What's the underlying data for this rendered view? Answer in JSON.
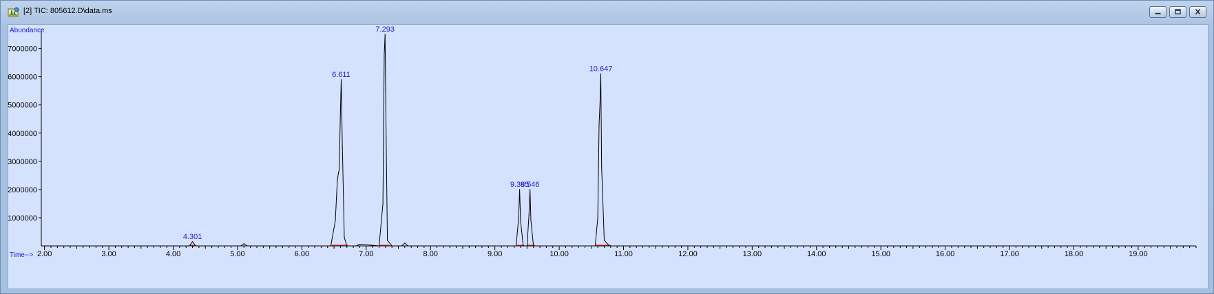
{
  "window": {
    "title": "[2] TIC: 805612.D\\data.ms",
    "icon": "chromatogram-app-icon",
    "controls": [
      "minimize",
      "restore",
      "close"
    ]
  },
  "chart_data": {
    "type": "line",
    "title": "",
    "xlabel": "Time-->",
    "ylabel": "Abundance",
    "xlim": [
      1.95,
      19.9
    ],
    "ylim": [
      0,
      7600000
    ],
    "x_ticks": [
      2.0,
      3.0,
      4.0,
      5.0,
      6.0,
      7.0,
      8.0,
      9.0,
      10.0,
      11.0,
      12.0,
      13.0,
      14.0,
      15.0,
      16.0,
      17.0,
      18.0,
      19.0
    ],
    "x_tick_labels": [
      "2.00",
      "3.00",
      "4.00",
      "5.00",
      "6.00",
      "7.00",
      "8.00",
      "9.00",
      "10.00",
      "11.00",
      "12.00",
      "13.00",
      "14.00",
      "15.00",
      "16.00",
      "17.00",
      "18.00",
      "19.00"
    ],
    "y_ticks": [
      1000000,
      2000000,
      3000000,
      4000000,
      5000000,
      6000000,
      7000000
    ],
    "y_tick_labels": [
      "1000000",
      "2000000",
      "3000000",
      "4000000",
      "5000000",
      "6000000",
      "7000000"
    ],
    "grid": false,
    "series": [
      {
        "line_color": "#000000",
        "x": [
          1.95,
          4.25,
          4.3,
          4.35,
          5.05,
          5.1,
          5.15,
          6.45,
          6.52,
          6.55,
          6.57,
          6.58,
          6.6,
          6.611,
          6.63,
          6.66,
          6.7,
          6.85,
          6.9,
          7.2,
          7.26,
          7.28,
          7.293,
          7.31,
          7.33,
          7.4,
          7.55,
          7.6,
          7.65,
          9.33,
          9.37,
          9.385,
          9.4,
          9.44,
          9.5,
          9.53,
          9.546,
          9.56,
          9.6,
          10.56,
          10.6,
          10.62,
          10.635,
          10.647,
          10.66,
          10.7,
          10.78,
          19.9
        ],
        "values": [
          0,
          0,
          150000,
          0,
          0,
          80000,
          0,
          0,
          900000,
          2300000,
          2600000,
          2700000,
          4800000,
          5900000,
          3500000,
          300000,
          0,
          0,
          60000,
          0,
          1500000,
          6800000,
          7500000,
          3800000,
          200000,
          0,
          0,
          100000,
          0,
          0,
          1000000,
          2000000,
          900000,
          0,
          0,
          1100000,
          2000000,
          900000,
          0,
          0,
          1000000,
          4300000,
          5100000,
          6100000,
          2800000,
          200000,
          0,
          0
        ]
      }
    ],
    "peaks": [
      {
        "rt": "4.301",
        "x": 4.301,
        "y": 150000
      },
      {
        "rt": "6.611",
        "x": 6.611,
        "y": 5900000
      },
      {
        "rt": "7.293",
        "x": 7.293,
        "y": 7500000
      },
      {
        "rt": "9.385",
        "x": 9.385,
        "y": 2000000
      },
      {
        "rt": "9.546",
        "x": 9.546,
        "y": 2000000
      },
      {
        "rt": "10.647",
        "x": 10.647,
        "y": 6100000
      }
    ],
    "baseline_marks": [
      [
        4.26,
        4.34
      ],
      [
        6.46,
        6.72
      ],
      [
        7.21,
        7.36
      ],
      [
        9.34,
        9.46
      ],
      [
        9.5,
        9.62
      ],
      [
        10.57,
        10.8
      ]
    ],
    "colors": {
      "background": "#d5e2fd",
      "trace": "#000000",
      "peak_labels": "#2020c8",
      "axis_titles": "#2020c8",
      "baseline": "#e02020"
    }
  }
}
